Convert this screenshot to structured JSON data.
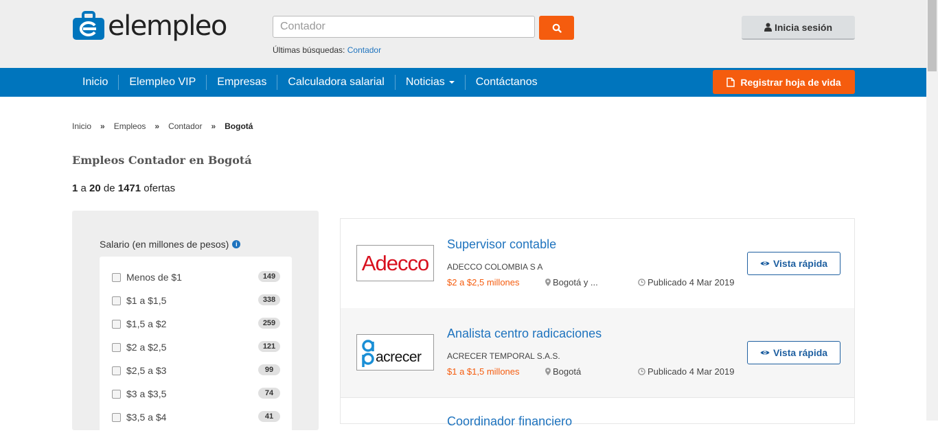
{
  "header": {
    "logo_text": "elempleo",
    "search_placeholder": "Contador",
    "recent_label": "Últimas búsquedas:",
    "recent_link": "Contador",
    "login_label": "Inicia sesión"
  },
  "nav": {
    "items": [
      "Inicio",
      "Elempleo VIP",
      "Empresas",
      "Calculadora salarial",
      "Noticias",
      "Contáctanos"
    ],
    "register_label": "Registrar hoja de vida"
  },
  "breadcrumb": [
    "Inicio",
    "Empleos",
    "Contador",
    "Bogotá"
  ],
  "breadcrumb_separator": "»",
  "page_title": "Empleos Contador en Bogotá",
  "results": {
    "from": "1",
    "a": "a",
    "to": "20",
    "de": "de",
    "total": "1471",
    "label": "ofertas"
  },
  "filter": {
    "title": "Salario (en millones de pesos)",
    "options": [
      {
        "label": "Menos de $1",
        "count": "149"
      },
      {
        "label": "$1 a $1,5",
        "count": "338"
      },
      {
        "label": "$1,5 a $2",
        "count": "259"
      },
      {
        "label": "$2 a $2,5",
        "count": "121"
      },
      {
        "label": "$2,5 a $3",
        "count": "99"
      },
      {
        "label": "$3 a $3,5",
        "count": "74"
      },
      {
        "label": "$3,5 a $4",
        "count": "41"
      }
    ]
  },
  "jobs": [
    {
      "title": "Supervisor contable",
      "company": "ADECCO COLOMBIA S A",
      "salary": "$2 a $2,5 millones",
      "location": "Bogotá y ...",
      "date": "Publicado 4 Mar 2019",
      "logo_text": "Adecco",
      "button": "Vista rápida"
    },
    {
      "title": "Analista centro radicaciones",
      "company": "ACRECER TEMPORAL S.A.S.",
      "salary": "$1 a $1,5 millones",
      "location": "Bogotá",
      "date": "Publicado 4 Mar 2019",
      "logo_text": "acrecer",
      "button": "Vista rápida"
    }
  ],
  "partial_job_title": "Coordinador financiero",
  "colors": {
    "primary": "#0075bd",
    "accent": "#f55c0e",
    "link": "#1e73be"
  }
}
